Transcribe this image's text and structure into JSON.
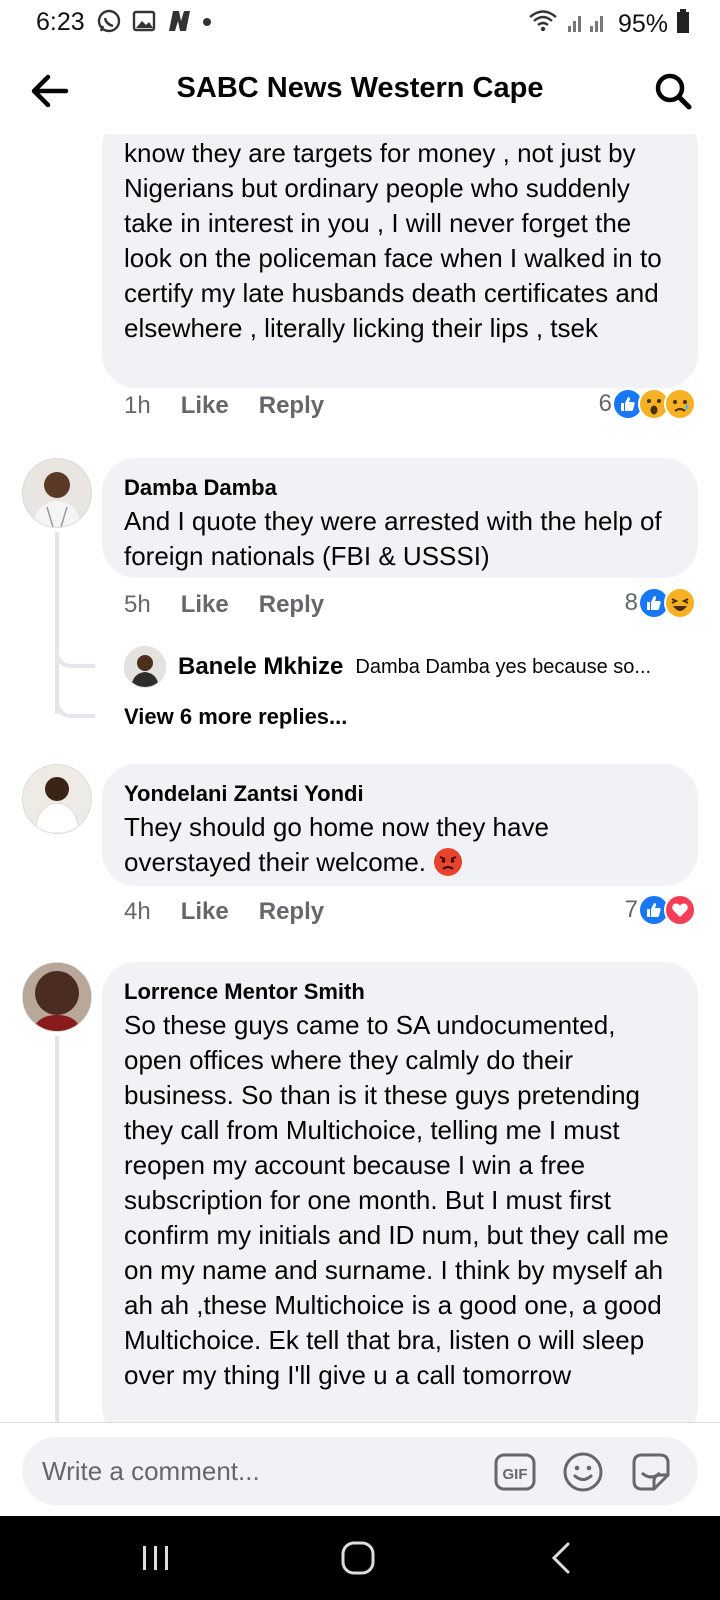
{
  "status": {
    "time": "6:23",
    "battery": "95%"
  },
  "header": {
    "title": "SABC News Western Cape"
  },
  "comments": [
    {
      "text": "know they are targets for money , not just by Nigerians but ordinary people who suddenly take in interest in you , I will never forget the look on the policeman face when I walked in to certify my late husbands death certificates and elsewhere , literally licking their lips , tsek",
      "time": "1h",
      "like": "Like",
      "reply": "Reply",
      "reactions_count": "6"
    },
    {
      "author": "Damba Damba",
      "text": "And I quote they were arrested  with the help of foreign nationals (FBI & USSSI)",
      "time": "5h",
      "like": "Like",
      "reply": "Reply",
      "reactions_count": "8",
      "reply_preview": {
        "author": "Banele Mkhize",
        "text": "Damba Damba yes because so..."
      },
      "more_replies": "View 6 more replies..."
    },
    {
      "author": "Yondelani Zantsi Yondi",
      "text": "They should go home now they have overstayed their welcome. ",
      "time": "4h",
      "like": "Like",
      "reply": "Reply",
      "reactions_count": "7"
    },
    {
      "author": "Lorrence Mentor Smith",
      "text": "So these guys came to SA undocumented, open offices where they calmly do their business. So than is it these guys pretending they call from Multichoice, telling me I must reopen my account because I win a free subscription for one month. But I must first confirm my initials and ID num,  but they call me on my name and surname. I think by myself ah ah ah ,these Multichoice is a good one, a good Multichoice. Ek tell that bra, listen o will sleep over my thing I'll give u a call tomorrow"
    }
  ],
  "composer": {
    "placeholder": "Write a comment..."
  },
  "icons": {
    "status": [
      "whatsapp-icon",
      "gallery-icon",
      "n-app-icon",
      "dot-icon",
      "wifi-icon",
      "signal-icon",
      "battery-icon"
    ],
    "header": [
      "back-arrow-icon",
      "search-icon"
    ],
    "reactions": [
      "like-reaction-icon",
      "wow-reaction-icon",
      "sad-reaction-icon",
      "haha-reaction-icon",
      "love-reaction-icon"
    ],
    "composer": [
      "gif-icon",
      "emoji-icon",
      "sticker-icon"
    ],
    "nav": [
      "recents-icon",
      "home-icon",
      "back-icon"
    ]
  },
  "colors": {
    "like_blue": "#1877f2",
    "love_red": "#f33e58",
    "bubble_gray": "#f0f2f5",
    "meta_gray": "#65676b"
  }
}
